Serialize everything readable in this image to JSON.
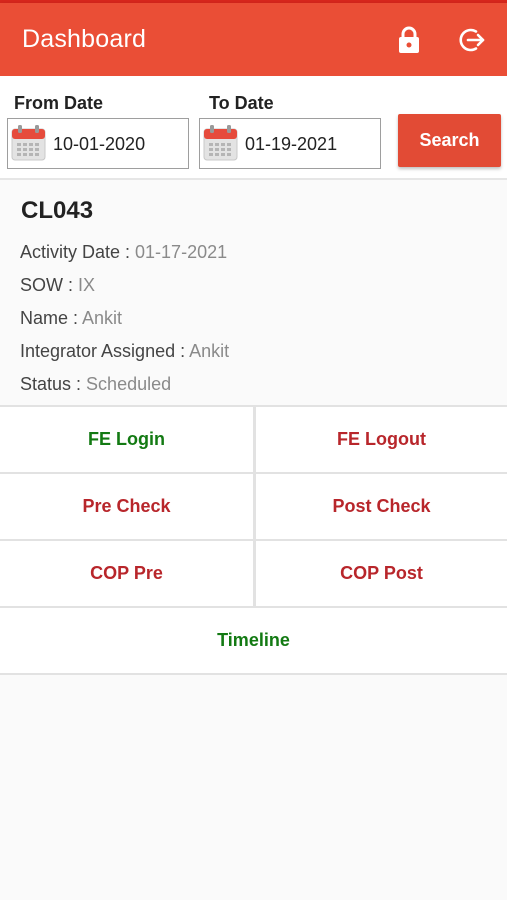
{
  "app": {
    "title": "Dashboard"
  },
  "icons": {
    "lock": "lock-icon",
    "logout": "logout-icon",
    "calendar": "calendar-icon"
  },
  "filter": {
    "from_label": "From Date",
    "to_label": "To Date",
    "from_value": "10-01-2020",
    "to_value": "01-19-2021",
    "search_label": "Search"
  },
  "card": {
    "id": "CL043",
    "activity_date_label": "Activity Date : ",
    "activity_date": "01-17-2021",
    "sow_label": "SOW : ",
    "sow": "IX",
    "name_label": "Name : ",
    "name": "Ankit",
    "integrator_label": "Integrator Assigned : ",
    "integrator": "Ankit",
    "status_label": "Status : ",
    "status": "Scheduled"
  },
  "actions": {
    "fe_login": "FE Login",
    "fe_logout": "FE Logout",
    "pre_check": "Pre Check",
    "post_check": "Post Check",
    "cop_pre": "COP Pre",
    "cop_post": "COP Post",
    "timeline": "Timeline"
  },
  "colors": {
    "appbar": "#ea4e36",
    "search_button": "#e24b35",
    "green_action": "#137a13",
    "red_action": "#b8262b"
  }
}
